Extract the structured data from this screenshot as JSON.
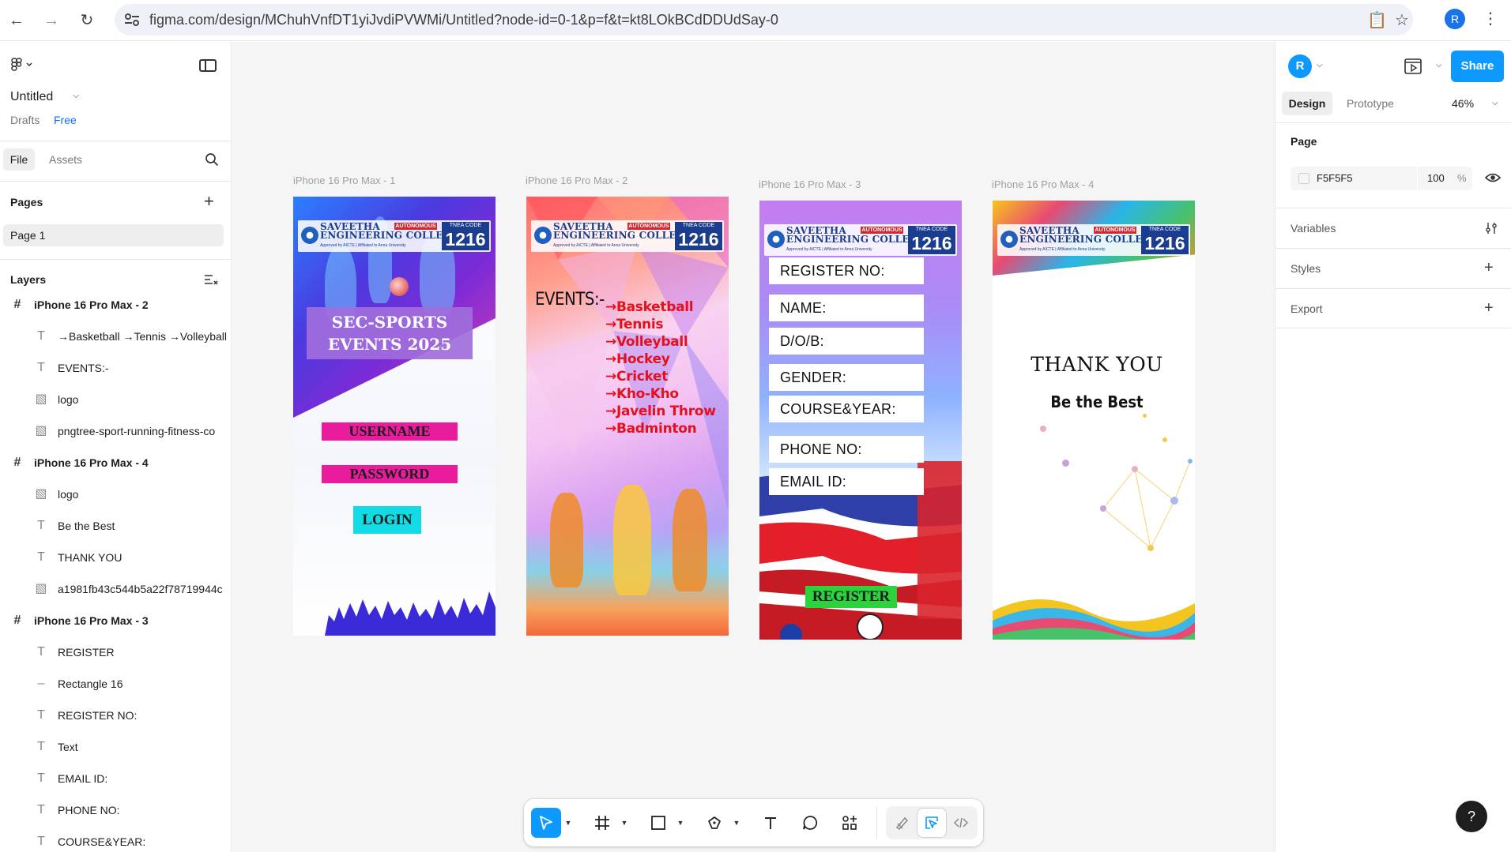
{
  "browser": {
    "url": "figma.com/design/MChuhVnfDT1yiJvdiPVWMi/Untitled?node-id=0-1&p=f&t=kt8LOkBCdDDUdSay-0",
    "profile_initial": "R"
  },
  "left_panel": {
    "file_title": "Untitled",
    "drafts_label": "Drafts",
    "plan_label": "Free",
    "tabs": {
      "file": "File",
      "assets": "Assets"
    },
    "pages_title": "Pages",
    "pages": [
      "Page 1"
    ],
    "layers_title": "Layers",
    "layers": [
      {
        "type": "frame",
        "name": "iPhone 16 Pro Max - 2"
      },
      {
        "type": "text",
        "name": "→Basketball →Tennis →Volleyball"
      },
      {
        "type": "text",
        "name": "EVENTS:-"
      },
      {
        "type": "image",
        "name": "logo"
      },
      {
        "type": "image",
        "name": "pngtree-sport-running-fitness-co"
      },
      {
        "type": "frame",
        "name": "iPhone 16 Pro Max - 4"
      },
      {
        "type": "image",
        "name": "logo"
      },
      {
        "type": "text",
        "name": "Be the Best"
      },
      {
        "type": "text",
        "name": "THANK YOU"
      },
      {
        "type": "image",
        "name": "a1981fb43c544b5a22f78719944c"
      },
      {
        "type": "frame",
        "name": "iPhone 16 Pro Max - 3"
      },
      {
        "type": "text",
        "name": "REGISTER"
      },
      {
        "type": "rect",
        "name": "Rectangle 16"
      },
      {
        "type": "text",
        "name": "REGISTER NO:"
      },
      {
        "type": "text",
        "name": "Text"
      },
      {
        "type": "text",
        "name": "EMAIL ID:"
      },
      {
        "type": "text",
        "name": "PHONE NO:"
      },
      {
        "type": "text",
        "name": "COURSE&YEAR:"
      }
    ]
  },
  "college": {
    "name_line1": "SAVEETHA",
    "name_line2": "ENGINEERING COLLEGE",
    "autonomous": "AUTONOMOUS",
    "code_label": "TNEA CODE",
    "code": "1216",
    "approval": "Approved by AICTE | Affiliated to Anna University"
  },
  "frames": [
    {
      "label": "iPhone 16 Pro Max - 1",
      "title_line1": "SEC-SPORTS",
      "title_line2": "EVENTS 2025",
      "username_label": "USERNAME",
      "password_label": "PASSWORD",
      "login_label": "LOGIN"
    },
    {
      "label": "iPhone 16 Pro Max - 2",
      "events_heading": "EVENTS:-",
      "events": [
        "→Basketball",
        "→Tennis",
        "→Volleyball",
        "→Hockey",
        "→Cricket",
        "→Kho-Kho",
        "→Javelin Throw",
        "→Badminton"
      ]
    },
    {
      "label": "iPhone 16 Pro Max - 3",
      "fields": [
        "REGISTER NO:",
        "NAME:",
        "D/O/B:",
        "GENDER:",
        "COURSE&YEAR:",
        "PHONE NO:",
        "EMAIL ID:"
      ],
      "register_label": "REGISTER"
    },
    {
      "label": "iPhone 16 Pro Max - 4",
      "thank_you": "THANK YOU",
      "tagline": "Be the Best"
    }
  ],
  "toolbar": {
    "tools": [
      "move-tool",
      "frame-tool",
      "shape-tool",
      "pen-tool",
      "text-tool",
      "comment-tool",
      "actions-tool"
    ],
    "modes": [
      "draw-mode",
      "design-mode",
      "dev-mode"
    ],
    "active_tool": "move-tool",
    "active_mode": "design-mode"
  },
  "right_panel": {
    "avatar_initial": "R",
    "share_label": "Share",
    "tabs": {
      "design": "Design",
      "prototype": "Prototype"
    },
    "zoom": "46%",
    "page_section": "Page",
    "page_color": "F5F5F5",
    "page_opacity": "100",
    "page_opacity_unit": "%",
    "variables_label": "Variables",
    "styles_label": "Styles",
    "export_label": "Export",
    "help_label": "?"
  },
  "colors": {
    "accent": "#0d99ff",
    "canvas_bg": "#F5F5F5"
  }
}
